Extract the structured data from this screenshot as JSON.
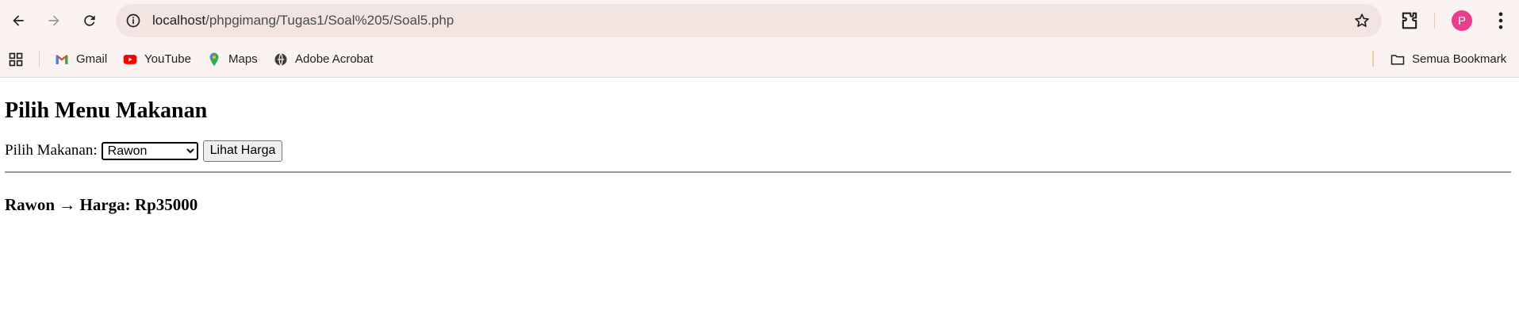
{
  "browser": {
    "url_host": "localhost",
    "url_path": "/phpgimang/Tugas1/Soal%205/Soal5.php",
    "profile_initial": "P"
  },
  "bookmarks": {
    "items": [
      {
        "label": "Gmail",
        "icon": "gmail-icon"
      },
      {
        "label": "YouTube",
        "icon": "youtube-icon"
      },
      {
        "label": "Maps",
        "icon": "maps-icon"
      },
      {
        "label": "Adobe Acrobat",
        "icon": "acrobat-icon"
      }
    ],
    "all_bookmarks_label": "Semua Bookmark"
  },
  "page": {
    "heading": "Pilih Menu Makanan",
    "select_label": "Pilih Makanan:",
    "selected_option": "Rawon",
    "submit_label": "Lihat Harga",
    "result_text": "Rawon → Harga: Rp35000"
  },
  "colors": {
    "chrome_bg": "#fbf3f1",
    "omnibox_bg": "#f1e4e1",
    "avatar_bg": "#e83e8c"
  }
}
